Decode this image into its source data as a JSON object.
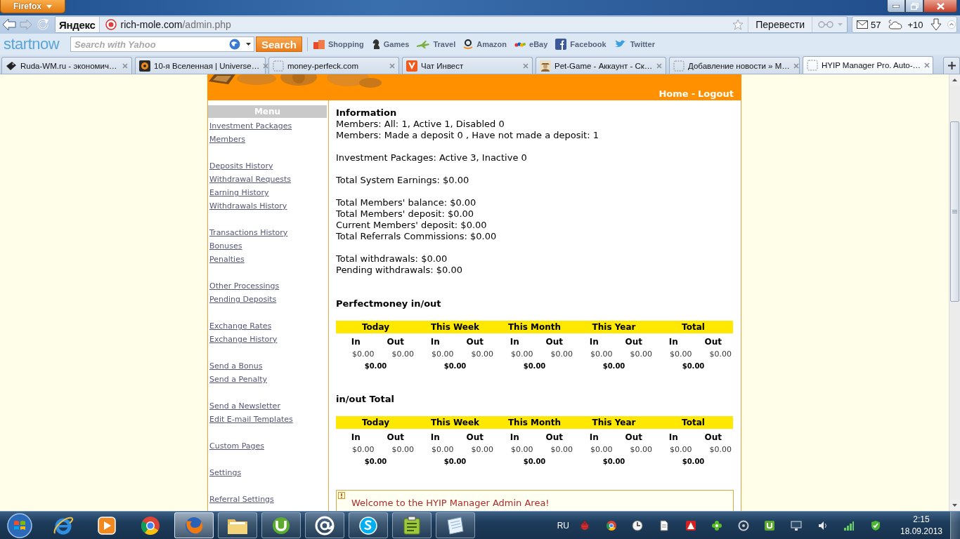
{
  "window": {
    "menu_button": "Firefox"
  },
  "navigation": {
    "search_badge": "Яндекс",
    "url": {
      "domain": "rich-mole.com",
      "path": "/admin.php"
    },
    "translate_button": "Перевести",
    "mail_count": "57",
    "weather": "+10"
  },
  "toolbar": {
    "logo": "startnow",
    "search": {
      "placeholder": "Search with Yahoo"
    },
    "search_button": "Search",
    "bookmarks": [
      {
        "label": "Shopping",
        "kind": "shopping"
      },
      {
        "label": "Games",
        "kind": "games"
      },
      {
        "label": "Travel",
        "kind": "travel"
      },
      {
        "label": "Amazon",
        "kind": "amazon"
      },
      {
        "label": "eBay",
        "kind": "ebay"
      },
      {
        "label": "Facebook",
        "kind": "facebook"
      },
      {
        "label": "Twitter",
        "kind": "twitter"
      }
    ]
  },
  "tabs": [
    {
      "title": "Ruda-WM.ru - экономич…",
      "kind": "tag",
      "selected": false
    },
    {
      "title": "10-я Вселенная | Universe…",
      "kind": "orb",
      "selected": false
    },
    {
      "title": "money-perfeck.com",
      "kind": "blank",
      "selected": false
    },
    {
      "title": "Чат Инвест",
      "kind": "vmark",
      "selected": false
    },
    {
      "title": "Pet-Game - Аккаунт - Ск…",
      "kind": "avatar",
      "selected": false
    },
    {
      "title": "Добавление новости » М…",
      "kind": "blank",
      "selected": false
    },
    {
      "title": "HYIP Manager Pro. Auto-…",
      "kind": "blank",
      "selected": true
    }
  ],
  "page": {
    "header_links": [
      {
        "label": "Home"
      },
      {
        "label": "Logout"
      }
    ],
    "header_separator": "-",
    "sidebar": {
      "title": "Menu",
      "groups": [
        [
          "Investment Packages",
          "Members"
        ],
        [
          "Deposits History",
          "Withdrawal Requests",
          "Earning History",
          "Withdrawals History"
        ],
        [
          "Transactions History",
          "Bonuses",
          "Penalties"
        ],
        [
          "Other Processings",
          "Pending Deposits"
        ],
        [
          "Exchange Rates",
          "Exchange History"
        ],
        [
          "Send a Bonus",
          "Send a Penalty"
        ],
        [
          "Send a Newsletter",
          "Edit E-mail Templates"
        ],
        [
          "Custom Pages"
        ],
        [
          "Settings"
        ],
        [
          "Referral Settings"
        ]
      ]
    },
    "information": {
      "title": "Information",
      "blocks": [
        [
          "Members: All: 1, Active 1, Disabled 0",
          "Members: Made a deposit 0 , Have not made a deposit: 1"
        ],
        [
          "Investment Packages: Active 3, Inactive 0"
        ],
        [
          "Total System Earnings: $0.00"
        ],
        [
          "Total Members' balance: $0.00",
          "Total Members' deposit: $0.00",
          "Current Members' deposit: $0.00",
          "Total Referrals Commissions: $0.00"
        ],
        [
          "Total withdrawals: $0.00",
          "Pending withdrawals: $0.00"
        ]
      ]
    },
    "tables": [
      {
        "title": "Perfectmoney in/out",
        "periods": [
          {
            "label": "Today",
            "in_label": "In",
            "out_label": "Out",
            "in": "$0.00",
            "out": "$0.00",
            "total": "$0.00"
          },
          {
            "label": "This Week",
            "in_label": "In",
            "out_label": "Out",
            "in": "$0.00",
            "out": "$0.00",
            "total": "$0.00"
          },
          {
            "label": "This Month",
            "in_label": "In",
            "out_label": "Out",
            "in": "$0.00",
            "out": "$0.00",
            "total": "$0.00"
          },
          {
            "label": "This Year",
            "in_label": "In",
            "out_label": "Out",
            "in": "$0.00",
            "out": "$0.00",
            "total": "$0.00"
          },
          {
            "label": "Total",
            "in_label": "In",
            "out_label": "Out",
            "in": "$0.00",
            "out": "$0.00",
            "total": "$0.00"
          }
        ]
      },
      {
        "title": "in/out Total",
        "periods": [
          {
            "label": "Today",
            "in_label": "In",
            "out_label": "Out",
            "in": "$0.00",
            "out": "$0.00",
            "total": "$0.00"
          },
          {
            "label": "This Week",
            "in_label": "In",
            "out_label": "Out",
            "in": "$0.00",
            "out": "$0.00",
            "total": "$0.00"
          },
          {
            "label": "This Month",
            "in_label": "In",
            "out_label": "Out",
            "in": "$0.00",
            "out": "$0.00",
            "total": "$0.00"
          },
          {
            "label": "This Year",
            "in_label": "In",
            "out_label": "Out",
            "in": "$0.00",
            "out": "$0.00",
            "total": "$0.00"
          },
          {
            "label": "Total",
            "in_label": "In",
            "out_label": "Out",
            "in": "$0.00",
            "out": "$0.00",
            "total": "$0.00"
          }
        ]
      }
    ],
    "notice": {
      "text": "Welcome to the HYIP Manager Admin Area!"
    }
  },
  "taskbar": {
    "apps": [
      {
        "kind": "ie",
        "running": false,
        "selected": false
      },
      {
        "kind": "media",
        "running": false,
        "selected": false
      },
      {
        "kind": "chrome",
        "running": false,
        "selected": false
      },
      {
        "kind": "firefox",
        "running": true,
        "selected": true
      },
      {
        "kind": "folder",
        "running": true,
        "selected": false
      },
      {
        "kind": "torrent",
        "running": true,
        "selected": false
      },
      {
        "kind": "agent",
        "running": true,
        "selected": false
      },
      {
        "kind": "skype",
        "running": true,
        "selected": false
      },
      {
        "kind": "notes",
        "running": true,
        "selected": false
      },
      {
        "kind": "paper",
        "running": true,
        "selected": false
      }
    ],
    "language": "RU",
    "time": "2:15",
    "date": "18.09.2013"
  }
}
